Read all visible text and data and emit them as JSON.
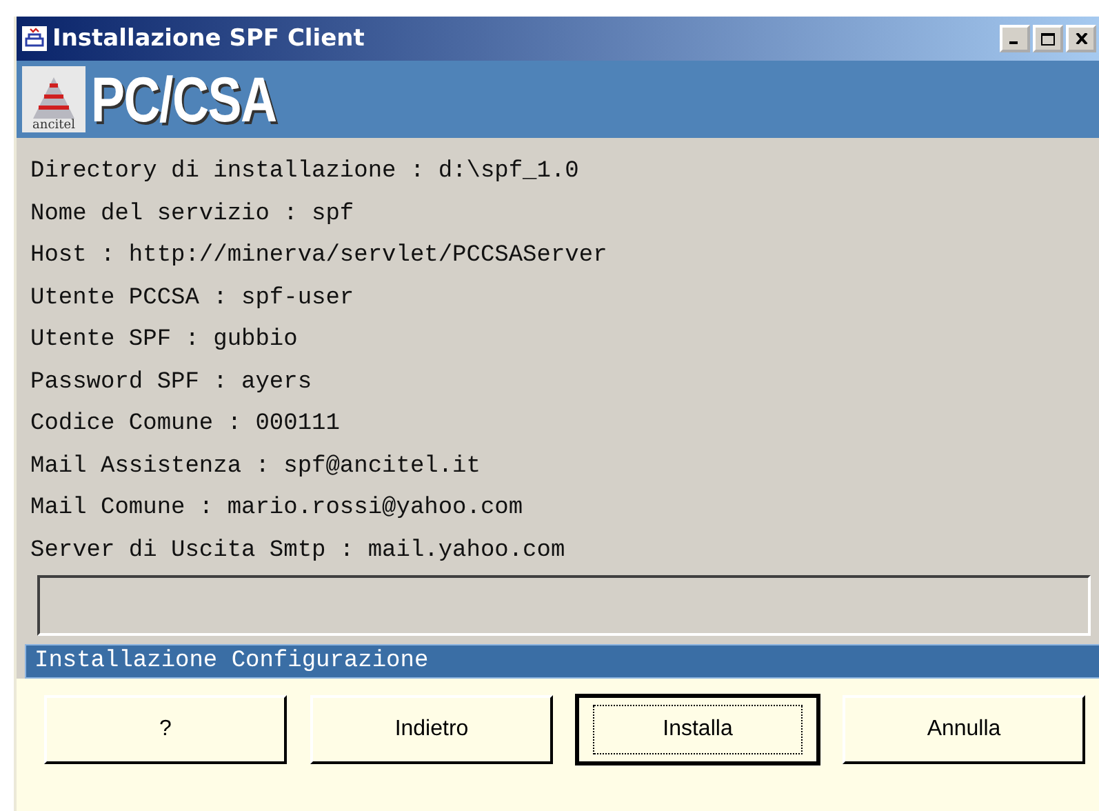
{
  "window": {
    "title": "Installazione SPF Client"
  },
  "banner": {
    "logo_text": "ancitel",
    "title": "PC/CSA"
  },
  "lines": [
    "Directory di installazione : d:\\spf_1.0",
    "Nome del servizio : spf",
    "Host : http://minerva/servlet/PCCSAServer",
    "Utente PCCSA : spf-user",
    "Utente SPF : gubbio",
    "Password SPF : ayers",
    "Codice Comune : 000111",
    "Mail Assistenza : spf@ancitel.it",
    "Mail Comune : mario.rossi@yahoo.com",
    "Server di Uscita Smtp : mail.yahoo.com"
  ],
  "status": "Installazione Configurazione",
  "buttons": [
    {
      "label": "?",
      "focused": false
    },
    {
      "label": "Indietro",
      "focused": false
    },
    {
      "label": "Installa",
      "focused": true
    },
    {
      "label": "Annulla",
      "focused": false
    }
  ]
}
